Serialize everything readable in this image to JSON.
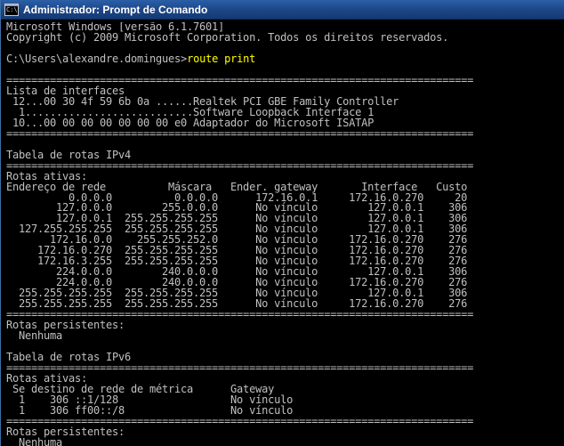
{
  "window": {
    "title": "Administrador: Prompt de Comando",
    "icon_text": "C:\\"
  },
  "console": {
    "prompt": "C:\\Users\\alexandre.domingues>",
    "command": "route print",
    "lines": [
      "Microsoft Windows [versão 6.1.7601]",
      "Copyright (c) 2009 Microsoft Corporation. Todos os direitos reservados.",
      "",
      "",
      "===========================================================================",
      "Lista de interfaces",
      " 12...00 30 4f 59 6b 0a ......Realtek PCI GBE Family Controller",
      "  1...........................Software Loopback Interface 1",
      " 10...00 00 00 00 00 00 00 e0 Adaptador do Microsoft ISATAP",
      "===========================================================================",
      "",
      "Tabela de rotas IPv4",
      "===========================================================================",
      "Rotas ativas:",
      "Endereço de rede          Máscara   Ender. gateway       Interface   Custo",
      "          0.0.0.0          0.0.0.0      172.16.0.1     172.16.0.270     20",
      "        127.0.0.0        255.0.0.0      No vínculo        127.0.0.1    306",
      "        127.0.0.1  255.255.255.255      No vínculo        127.0.0.1    306",
      "  127.255.255.255  255.255.255.255      No vínculo        127.0.0.1    306",
      "       172.16.0.0    255.255.252.0      No vínculo     172.16.0.270    276",
      "     172.16.0.270  255.255.255.255      No vínculo     172.16.0.270    276",
      "     172.16.3.255  255.255.255.255      No vínculo     172.16.0.270    276",
      "        224.0.0.0        240.0.0.0      No vínculo        127.0.0.1    306",
      "        224.0.0.0        240.0.0.0      No vínculo     172.16.0.270    276",
      "  255.255.255.255  255.255.255.255      No vínculo        127.0.0.1    306",
      "  255.255.255.255  255.255.255.255      No vínculo     172.16.0.270    276",
      "===========================================================================",
      "Rotas persistentes:",
      "  Nenhuma",
      "",
      "Tabela de rotas IPv6",
      "===========================================================================",
      "Rotas ativas:",
      " Se destino de rede de métrica      Gateway",
      "  1    306 ::1/128                  No vínculo",
      "  1    306 ff00::/8                 No vínculo",
      "===========================================================================",
      "Rotas persistentes:",
      "  Nenhuma"
    ]
  }
}
